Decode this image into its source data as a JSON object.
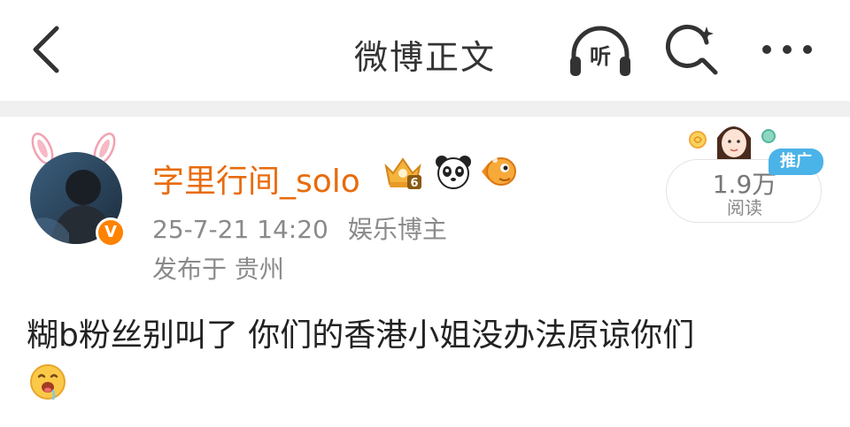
{
  "navbar": {
    "title": "微博正文",
    "listen_label": "听",
    "back_icon": "back-arrow-icon",
    "search_icon": "search-icon",
    "more_icon": "more-icon"
  },
  "post": {
    "username": "字里行间_solo",
    "timestamp": "25-7-21 14:20",
    "tag": "娱乐博主",
    "location": "发布于 贵州",
    "verified": "V",
    "text": "糊b粉丝别叫了 你们的香港小姐没办法原谅你们",
    "badges": [
      "crown-level-6-icon",
      "panda-icon",
      "fish-icon"
    ],
    "emoji": "drooling-face-icon"
  },
  "read_stats": {
    "count": "1.9万",
    "label": "阅读",
    "promo_tag": "推广"
  },
  "colors": {
    "username": "#e86b0c",
    "meta": "#8a8a8a",
    "accent": "#ff8200",
    "promo": "#4ab3e8"
  }
}
